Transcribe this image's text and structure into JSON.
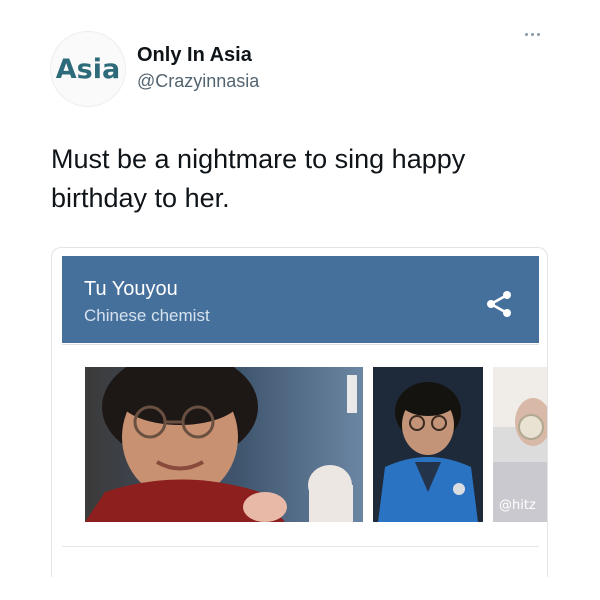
{
  "tweet": {
    "author": {
      "display_name": "Only In Asia",
      "handle": "@Crazyinnasia",
      "avatar_text": "Asia",
      "avatar_icon": "asia-logo"
    },
    "text": "Must be a nightmare to sing happy birthday to her.",
    "more_icon": "more-dots-icon"
  },
  "knowledge_card": {
    "title": "Tu Youyou",
    "subtitle": "Chinese chemist",
    "share_icon": "share-icon",
    "header_color": "#46709c",
    "images": [
      {
        "name": "portrait-smiling"
      },
      {
        "name": "portrait-blue-jacket"
      },
      {
        "name": "lab-flask-photo",
        "watermark": "@hitz"
      }
    ]
  }
}
